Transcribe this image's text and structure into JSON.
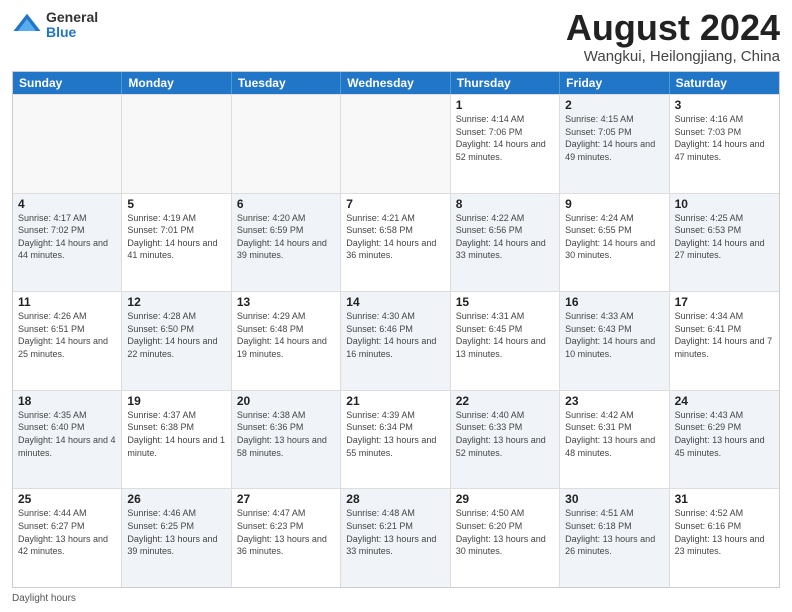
{
  "logo": {
    "general": "General",
    "blue": "Blue"
  },
  "title": {
    "month": "August 2024",
    "location": "Wangkui, Heilongjiang, China"
  },
  "header_days": [
    "Sunday",
    "Monday",
    "Tuesday",
    "Wednesday",
    "Thursday",
    "Friday",
    "Saturday"
  ],
  "weeks": [
    [
      {
        "day": "",
        "info": ""
      },
      {
        "day": "",
        "info": ""
      },
      {
        "day": "",
        "info": ""
      },
      {
        "day": "",
        "info": ""
      },
      {
        "day": "1",
        "info": "Sunrise: 4:14 AM\nSunset: 7:06 PM\nDaylight: 14 hours and 52 minutes."
      },
      {
        "day": "2",
        "info": "Sunrise: 4:15 AM\nSunset: 7:05 PM\nDaylight: 14 hours and 49 minutes."
      },
      {
        "day": "3",
        "info": "Sunrise: 4:16 AM\nSunset: 7:03 PM\nDaylight: 14 hours and 47 minutes."
      }
    ],
    [
      {
        "day": "4",
        "info": "Sunrise: 4:17 AM\nSunset: 7:02 PM\nDaylight: 14 hours and 44 minutes."
      },
      {
        "day": "5",
        "info": "Sunrise: 4:19 AM\nSunset: 7:01 PM\nDaylight: 14 hours and 41 minutes."
      },
      {
        "day": "6",
        "info": "Sunrise: 4:20 AM\nSunset: 6:59 PM\nDaylight: 14 hours and 39 minutes."
      },
      {
        "day": "7",
        "info": "Sunrise: 4:21 AM\nSunset: 6:58 PM\nDaylight: 14 hours and 36 minutes."
      },
      {
        "day": "8",
        "info": "Sunrise: 4:22 AM\nSunset: 6:56 PM\nDaylight: 14 hours and 33 minutes."
      },
      {
        "day": "9",
        "info": "Sunrise: 4:24 AM\nSunset: 6:55 PM\nDaylight: 14 hours and 30 minutes."
      },
      {
        "day": "10",
        "info": "Sunrise: 4:25 AM\nSunset: 6:53 PM\nDaylight: 14 hours and 27 minutes."
      }
    ],
    [
      {
        "day": "11",
        "info": "Sunrise: 4:26 AM\nSunset: 6:51 PM\nDaylight: 14 hours and 25 minutes."
      },
      {
        "day": "12",
        "info": "Sunrise: 4:28 AM\nSunset: 6:50 PM\nDaylight: 14 hours and 22 minutes."
      },
      {
        "day": "13",
        "info": "Sunrise: 4:29 AM\nSunset: 6:48 PM\nDaylight: 14 hours and 19 minutes."
      },
      {
        "day": "14",
        "info": "Sunrise: 4:30 AM\nSunset: 6:46 PM\nDaylight: 14 hours and 16 minutes."
      },
      {
        "day": "15",
        "info": "Sunrise: 4:31 AM\nSunset: 6:45 PM\nDaylight: 14 hours and 13 minutes."
      },
      {
        "day": "16",
        "info": "Sunrise: 4:33 AM\nSunset: 6:43 PM\nDaylight: 14 hours and 10 minutes."
      },
      {
        "day": "17",
        "info": "Sunrise: 4:34 AM\nSunset: 6:41 PM\nDaylight: 14 hours and 7 minutes."
      }
    ],
    [
      {
        "day": "18",
        "info": "Sunrise: 4:35 AM\nSunset: 6:40 PM\nDaylight: 14 hours and 4 minutes."
      },
      {
        "day": "19",
        "info": "Sunrise: 4:37 AM\nSunset: 6:38 PM\nDaylight: 14 hours and 1 minute."
      },
      {
        "day": "20",
        "info": "Sunrise: 4:38 AM\nSunset: 6:36 PM\nDaylight: 13 hours and 58 minutes."
      },
      {
        "day": "21",
        "info": "Sunrise: 4:39 AM\nSunset: 6:34 PM\nDaylight: 13 hours and 55 minutes."
      },
      {
        "day": "22",
        "info": "Sunrise: 4:40 AM\nSunset: 6:33 PM\nDaylight: 13 hours and 52 minutes."
      },
      {
        "day": "23",
        "info": "Sunrise: 4:42 AM\nSunset: 6:31 PM\nDaylight: 13 hours and 48 minutes."
      },
      {
        "day": "24",
        "info": "Sunrise: 4:43 AM\nSunset: 6:29 PM\nDaylight: 13 hours and 45 minutes."
      }
    ],
    [
      {
        "day": "25",
        "info": "Sunrise: 4:44 AM\nSunset: 6:27 PM\nDaylight: 13 hours and 42 minutes."
      },
      {
        "day": "26",
        "info": "Sunrise: 4:46 AM\nSunset: 6:25 PM\nDaylight: 13 hours and 39 minutes."
      },
      {
        "day": "27",
        "info": "Sunrise: 4:47 AM\nSunset: 6:23 PM\nDaylight: 13 hours and 36 minutes."
      },
      {
        "day": "28",
        "info": "Sunrise: 4:48 AM\nSunset: 6:21 PM\nDaylight: 13 hours and 33 minutes."
      },
      {
        "day": "29",
        "info": "Sunrise: 4:50 AM\nSunset: 6:20 PM\nDaylight: 13 hours and 30 minutes."
      },
      {
        "day": "30",
        "info": "Sunrise: 4:51 AM\nSunset: 6:18 PM\nDaylight: 13 hours and 26 minutes."
      },
      {
        "day": "31",
        "info": "Sunrise: 4:52 AM\nSunset: 6:16 PM\nDaylight: 13 hours and 23 minutes."
      }
    ]
  ],
  "footer": {
    "daylight_hours": "Daylight hours"
  }
}
